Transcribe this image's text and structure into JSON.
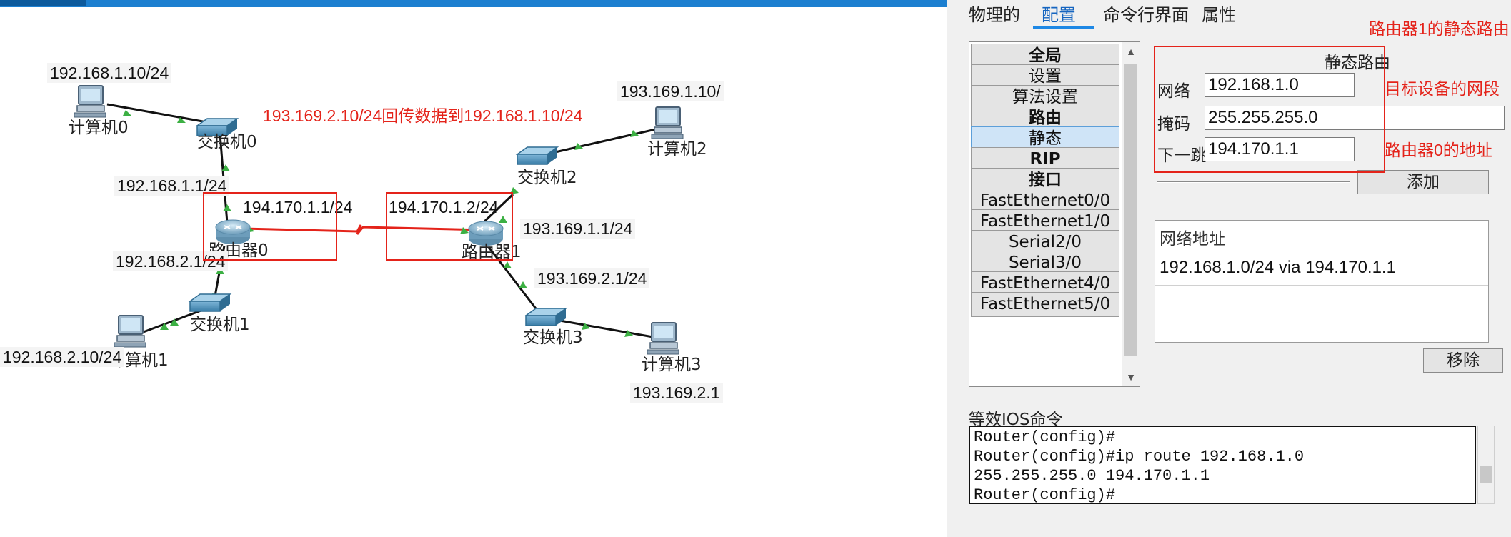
{
  "topology": {
    "devices": {
      "pc0": "计算机0",
      "pc1": "计算机1",
      "pc2": "计算机2",
      "pc3": "计算机3",
      "switch0": "交换机0",
      "switch1": "交换机1",
      "switch2": "交换机2",
      "switch3": "交换机3",
      "router0": "路由器0",
      "router1": "路由器1"
    },
    "ip_labels": {
      "pc0_ip": "192.168.1.10/24",
      "pc1_ip": "192.168.2.10/24",
      "pc2_ip": "193.169.1.10/",
      "pc3_ip": "193.169.2.1",
      "r0_lan1": "192.168.1.1/24",
      "r0_lan2": "192.168.2.1/24",
      "r0_serial": "194.170.1.1/24",
      "r1_serial": "194.170.1.2/24",
      "r1_lan1": "193.169.1.1/24",
      "r1_lan2": "193.169.2.1/24"
    },
    "annotation": "193.169.2.10/24回传数据到192.168.1.10/24"
  },
  "panel": {
    "tabs": [
      "物理的",
      "配置",
      "命令行界面",
      "属性"
    ],
    "active_tab": "配置",
    "annotation_title": "路由器1的静态路由",
    "menu": [
      {
        "label": "全局",
        "bold": true
      },
      {
        "label": "设置",
        "bold": false
      },
      {
        "label": "算法设置",
        "bold": false
      },
      {
        "label": "路由",
        "bold": true
      },
      {
        "label": "静态",
        "bold": false,
        "selected": true
      },
      {
        "label": "RIP",
        "bold": true
      },
      {
        "label": "接口",
        "bold": true
      },
      {
        "label": "FastEthernet0/0",
        "bold": false
      },
      {
        "label": "FastEthernet1/0",
        "bold": false
      },
      {
        "label": "Serial2/0",
        "bold": false
      },
      {
        "label": "Serial3/0",
        "bold": false
      },
      {
        "label": "FastEthernet4/0",
        "bold": false
      },
      {
        "label": "FastEthernet5/0",
        "bold": false
      }
    ],
    "form": {
      "heading": "静态路由",
      "network_label": "网络",
      "network_value": "192.168.1.0",
      "mask_label": "掩码",
      "mask_value": "255.255.255.0",
      "nexthop_label": "下一跳",
      "nexthop_value": "194.170.1.1",
      "add_button": "添加",
      "network_annotation": "目标设备的网段",
      "nexthop_annotation": "路由器0的地址"
    },
    "routes": {
      "header": "网络地址",
      "rows": [
        "192.168.1.0/24 via 194.170.1.1"
      ],
      "remove_button": "移除"
    },
    "ios": {
      "label": "等效IOS命令",
      "lines": [
        "Router(config)#",
        "Router(config)#ip route 192.168.1.0",
        "255.255.255.0 194.170.1.1",
        "Router(config)#"
      ]
    }
  },
  "colors": {
    "annotation_red": "#e4231a",
    "link_black": "#111111",
    "link_red": "#e4231a",
    "port_green": "#3cb043",
    "accent_blue": "#1e88e5"
  }
}
